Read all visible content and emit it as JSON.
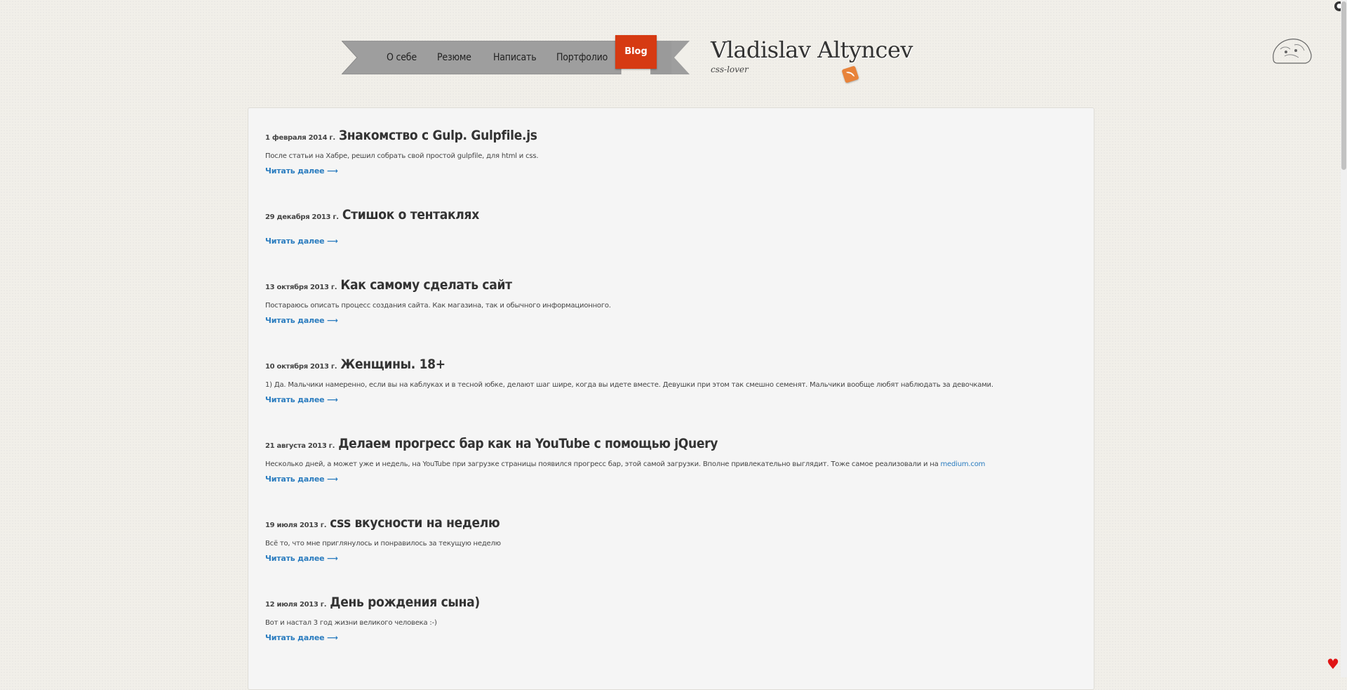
{
  "nav": {
    "items": [
      "О себе",
      "Резюме",
      "Написать",
      "Портфолио"
    ],
    "active": "Blog"
  },
  "brand": {
    "title": "Vladislav Altyncev",
    "subtitle": "css-lover"
  },
  "posts": [
    {
      "date": "1 февраля 2014 г.",
      "title": "Знакомство с Gulp. Gulpfile.js",
      "excerpt": "После статьи на Хабре, решил собрать свой простой gulpfile, для html и css.",
      "read_more": "Читать далее ⟶"
    },
    {
      "date": "29 декабря 2013 г.",
      "title": "Стишок о тентаклях",
      "excerpt": "",
      "read_more": "Читать далее ⟶"
    },
    {
      "date": "13 октября 2013 г.",
      "title": "Как самому сделать сайт",
      "excerpt": "Постараюсь описать процесс создания сайта. Как магазина, так и обычного информационного.",
      "read_more": "Читать далее ⟶"
    },
    {
      "date": "10 октября 2013 г.",
      "title": "Женщины. 18+",
      "excerpt": "1) Да. Мальчики намеренно, если вы на каблуках и в тесной юбке, делают шаг шире, когда вы идете вместе. Девушки при этом так смешно семенят. Мальчики вообще любят наблюдать за девочками.",
      "read_more": "Читать далее ⟶"
    },
    {
      "date": "21 августа 2013 г.",
      "title": "Делаем прогресс бар как на YouTube с помощью jQuery",
      "excerpt": "Несколько дней, а может уже и недель, на YouTube при загрузке страницы появился прогресс бар, этой самой загрузки. Вполне привлекательно выглядит. Тоже самое реализовали и на",
      "excerpt_link": "medium.com",
      "read_more": "Читать далее ⟶"
    },
    {
      "date": "19 июля 2013 г.",
      "title": "css вкусности на неделю",
      "excerpt": "Всё то, что мне приглянулось и понравилось за текущую неделю",
      "read_more": "Читать далее ⟶"
    },
    {
      "date": "12 июля 2013 г.",
      "title": "День рождения сына)",
      "excerpt": "Вот и настал 3 год жизни великого человека :-)",
      "read_more": "Читать далее ⟶"
    }
  ],
  "colors": {
    "accent": "#d63a12",
    "link": "#2a7cbf",
    "ribbon": "#9a9a9a",
    "rss": "#e8833a"
  },
  "icons": [
    "github-icon",
    "rss-icon",
    "sketch-icon",
    "heart-icon"
  ]
}
